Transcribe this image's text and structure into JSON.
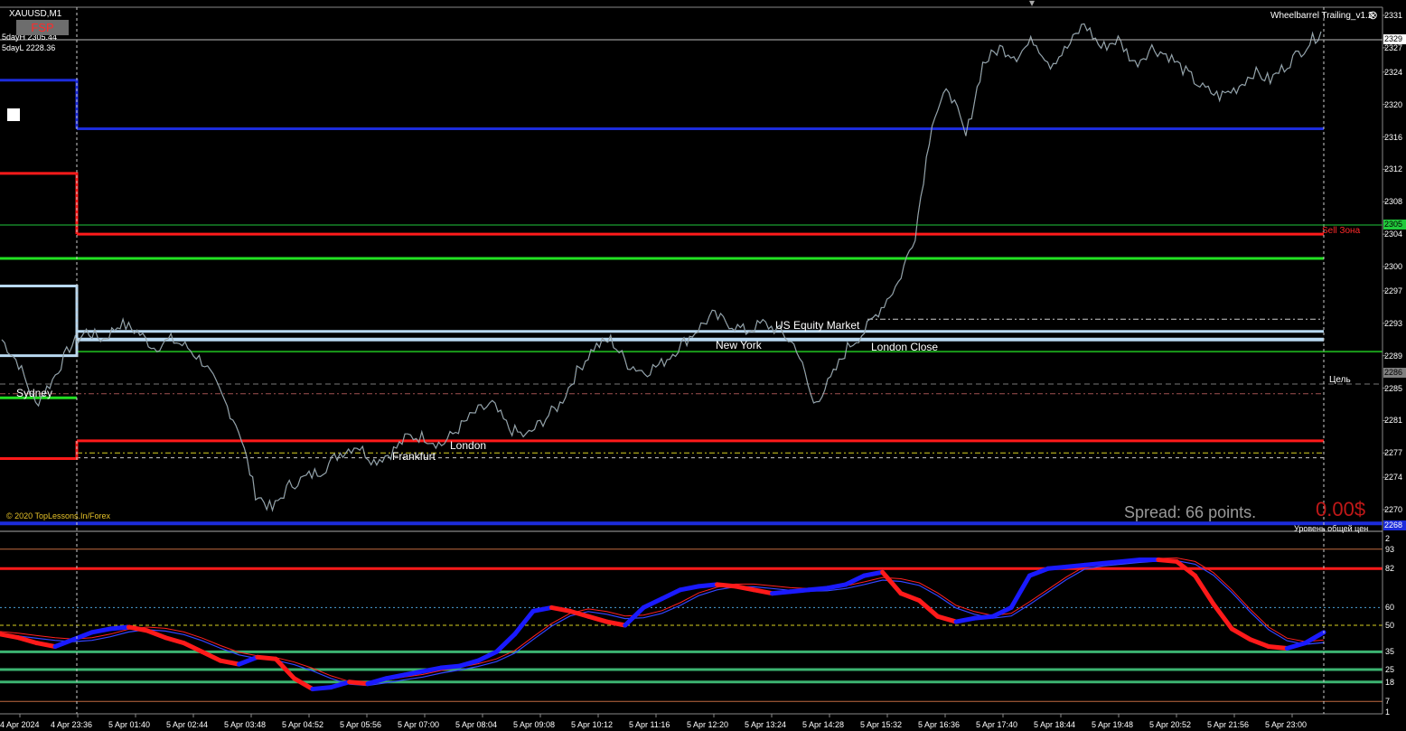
{
  "chart_data": {
    "type": "line",
    "symbol": "XAUUSD,M1",
    "title": "XAUUSD,M1",
    "indicator_title": "Wheelbarrel Trailing_v1.2",
    "five_day_high": "5dayH 2305.44",
    "five_day_low": "5dayL 2228.36",
    "fsp_label": "FSP",
    "copyright": "© 2020 TopLessons.In/Forex",
    "spread_text": "Spread: 66 points.",
    "profit_text": "0.00$",
    "bottom_right_text": "Уровень общей цен",
    "sell_zone_label": "Sell Зона",
    "target_label": "Цель",
    "sessions": [
      "Sydney",
      "Frankfurt",
      "London",
      "US Equity Market",
      "New York",
      "London Close"
    ],
    "price_axis": [
      "2331",
      "2327",
      "2324",
      "2320",
      "2316",
      "2312",
      "2308",
      "2304",
      "2300",
      "2297",
      "2293",
      "2289",
      "2285",
      "2281",
      "2277",
      "2274",
      "2270"
    ],
    "price_tags": {
      "current": "2329",
      "bid": "2305",
      "target": "2286",
      "bottom": "2268"
    },
    "time_axis": [
      "4 Apr 2024",
      "4 Apr 23:36",
      "5 Apr 01:40",
      "5 Apr 02:44",
      "5 Apr 03:48",
      "5 Apr 04:52",
      "5 Apr 05:56",
      "5 Apr 07:00",
      "5 Apr 08:04",
      "5 Apr 09:08",
      "5 Apr 10:12",
      "5 Apr 11:16",
      "5 Apr 12:20",
      "5 Apr 13:24",
      "5 Apr 14:28",
      "5 Apr 15:32",
      "5 Apr 16:36",
      "5 Apr 17:40",
      "5 Apr 18:44",
      "5 Apr 19:48",
      "5 Apr 20:52",
      "5 Apr 21:56",
      "5 Apr 23:00"
    ],
    "ylim": [
      2268,
      2332
    ],
    "series": [
      {
        "values": [
          2291,
          2288,
          2283,
          2286,
          2290,
          2292,
          2291,
          2293,
          2292,
          2290,
          2291,
          2290,
          2288,
          2284,
          2280,
          2272,
          2270,
          2273,
          2274,
          2275,
          2277,
          2278,
          2276,
          2277,
          2279,
          2279,
          2278,
          2280,
          2282,
          2283,
          2280,
          2279,
          2281,
          2283,
          2287,
          2290,
          2291,
          2288,
          2287,
          2288,
          2290,
          2292,
          2294,
          2293,
          2292,
          2293,
          2292,
          2290,
          2283,
          2286,
          2290,
          2292,
          2295,
          2298,
          2304,
          2318,
          2322,
          2316,
          2325,
          2327,
          2326,
          2328,
          2325,
          2327,
          2330,
          2327,
          2328,
          2325,
          2327,
          2326,
          2324,
          2322,
          2321,
          2322,
          2324,
          2323,
          2325,
          2327,
          2329
        ]
      }
    ],
    "horizontal_levels": {
      "upper_blue": 2317,
      "red_sell": 2304,
      "green": 2301,
      "light_blue_1": 2292,
      "light_blue_2": 2291,
      "dark_green": 2289.5,
      "target": 2285.5,
      "red_lower": 2278.5,
      "yellow": 2277,
      "bottom_blue": 2268.3
    },
    "oscillator": {
      "axis": [
        "2",
        "93",
        "82",
        "60",
        "50",
        "35",
        "25",
        "18",
        "7",
        "1"
      ],
      "ylim": [
        0,
        100
      ],
      "levels": [
        93,
        82,
        60,
        50,
        35,
        25,
        18,
        7
      ],
      "series": [
        {
          "values": [
            45,
            43,
            40,
            38,
            42,
            46,
            48,
            49,
            47,
            43,
            40,
            35,
            30,
            28,
            32,
            31,
            20,
            14,
            15,
            18,
            17,
            20,
            22,
            24,
            26,
            27,
            30,
            35,
            45,
            58,
            60,
            58,
            55,
            52,
            50,
            60,
            65,
            70,
            72,
            73,
            72,
            70,
            68,
            69,
            70,
            71,
            73,
            78,
            80,
            68,
            64,
            55,
            52,
            54,
            55,
            60,
            78,
            82,
            83,
            84,
            85,
            86,
            87,
            87,
            86,
            78,
            62,
            48,
            42,
            38,
            37,
            40,
            46
          ]
        }
      ]
    }
  }
}
